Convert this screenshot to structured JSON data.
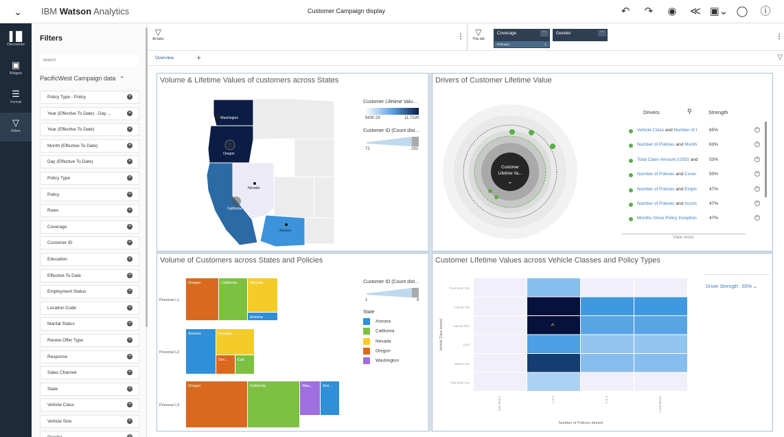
{
  "app": {
    "brand_light": "IBM ",
    "brand_bold": "Watson",
    "brand_rest": " Analytics",
    "doc_title": "Customer Campaign display",
    "icons": [
      "chevron-down-icon",
      "undo-icon",
      "redo-icon",
      "eye-icon",
      "share-icon",
      "settings-icon",
      "user-icon",
      "help-icon"
    ]
  },
  "rail": [
    {
      "label": "Discoveries",
      "icon": "discoveries-icon"
    },
    {
      "label": "Widgets",
      "icon": "widgets-icon"
    },
    {
      "label": "Format",
      "icon": "format-icon"
    },
    {
      "label": "Filters",
      "icon": "filters-icon"
    }
  ],
  "filters": {
    "title": "Filters",
    "search_placeholder": "Search",
    "source": "PacificWest Campaign data",
    "items": [
      "Policy Type - Policy",
      "Year (Effective To Date) - Day ...",
      "Year (Effective To Date)",
      "Month (Effective To Date)",
      "Day (Effective To Date)",
      "Policy Type",
      "Policy",
      "Rows",
      "Coverage",
      "Customer ID",
      "Education",
      "Effective To Date",
      "Employment Status",
      "Location Code",
      "Marital Status",
      "Renew Offer Type",
      "Response",
      "Sales Channel",
      "State",
      "Vehicle Class",
      "Vehicle Size",
      "Gender"
    ]
  },
  "filterbar": {
    "all_tabs": "All tabs",
    "this_tab": "This tab",
    "chips": [
      {
        "label": "Coverage",
        "sub": "Premium",
        "count": "1"
      },
      {
        "label": "Gender",
        "sub": "",
        "count": ""
      }
    ]
  },
  "tabs": {
    "overview": "Overview",
    "add": "+"
  },
  "tiles": {
    "map": {
      "title": "Volume & Lifetime Values of customers across States",
      "legend_color_title": "Customer Lifetime Valu…",
      "legend_color_min": "9430.29",
      "legend_color_max": "11,732K",
      "legend_size_title": "Customer ID (Count dist…",
      "legend_size_min": "72",
      "legend_size_max": "292",
      "states": [
        "Washington",
        "Oregon",
        "California",
        "Nevada",
        "Arizona"
      ]
    },
    "drivers": {
      "title": "Drivers of Customer Lifetime Value",
      "center_label": "Customer Lifetime Va...",
      "col_drivers": "Drivers",
      "col_strength": "Strength",
      "rows": [
        {
          "a": "Vehicle Class",
          "b": " and ",
          "c": "Number of I",
          "v": "65%"
        },
        {
          "a": "Number of Policies",
          "b": " and ",
          "c": "Month",
          "v": "63%"
        },
        {
          "a": "Total Claim Amount (USD)",
          "b": " and ",
          "c": "",
          "v": "53%"
        },
        {
          "a": "Number of Policies",
          "b": " and ",
          "c": "Cover",
          "v": "50%"
        },
        {
          "a": "Number of Policies",
          "b": " and ",
          "c": "Emplc",
          "v": "47%"
        },
        {
          "a": "Number of Policies",
          "b": " and ",
          "c": "Incom",
          "v": "47%"
        },
        {
          "a": "Months Since Policy Inception",
          "b": "",
          "c": "",
          "v": "47%"
        }
      ],
      "view_more": "View more"
    },
    "treemap": {
      "title": "Volume of Customers across States and Policies",
      "legend_size_title": "Customer ID (Count dist…",
      "legend_size_min": "1",
      "legend_size_max": "8",
      "legend_state_title": "State",
      "row_labels": [
        "Personal L1",
        "Personal L2",
        "Personal L3"
      ],
      "legend": [
        {
          "name": "Arizona",
          "color": "#2f8fd8"
        },
        {
          "name": "California",
          "color": "#7cc142"
        },
        {
          "name": "Nevada",
          "color": "#f4cc2a"
        },
        {
          "name": "Oregon",
          "color": "#d9691e"
        },
        {
          "name": "Washington",
          "color": "#9f6fe0"
        }
      ],
      "cells": [
        {
          "row": 0,
          "label": "Oregon",
          "state": "Oregon"
        },
        {
          "row": 0,
          "label": "California",
          "state": "California"
        },
        {
          "row": 0,
          "label": "Nevada",
          "state": "Nevada"
        },
        {
          "row": 0,
          "label": "Arizona",
          "state": "Arizona"
        },
        {
          "row": 1,
          "label": "Arizona",
          "state": "Arizona"
        },
        {
          "row": 1,
          "label": "Nevada",
          "state": "Nevada"
        },
        {
          "row": 1,
          "label": "Ore...",
          "state": "Oregon"
        },
        {
          "row": 1,
          "label": "Cali",
          "state": "California"
        },
        {
          "row": 2,
          "label": "Oregon",
          "state": "Oregon"
        },
        {
          "row": 2,
          "label": "California",
          "state": "California"
        },
        {
          "row": 2,
          "label": "Was...",
          "state": "Washington"
        },
        {
          "row": 2,
          "label": "Ariz...",
          "state": "Arizona"
        }
      ]
    },
    "heatmap": {
      "title": "Customer LIfetime Values across Vehicle Classes and Policy Types",
      "driver_strength": "Driver Strength : 65%",
      "x_title": "Number of Policies binned",
      "y_title": "Vehicle Class binned",
      "y_labels": [
        "Four-Door Car",
        "Luxury Car",
        "Luxury SUV",
        "SUV",
        "Sports Car",
        "Two-Door Car"
      ],
      "x_labels": [
        "less than 1",
        "1 to 3",
        "3 to 5",
        "5 and above"
      ],
      "values": [
        [
          null,
          0.35,
          null,
          null
        ],
        [
          null,
          1.0,
          0.65,
          0.65
        ],
        [
          null,
          1.0,
          0.55,
          0.55
        ],
        [
          null,
          0.6,
          0.3,
          0.3
        ],
        [
          null,
          0.9,
          0.35,
          0.35
        ],
        [
          null,
          0.2,
          null,
          null
        ]
      ]
    }
  }
}
